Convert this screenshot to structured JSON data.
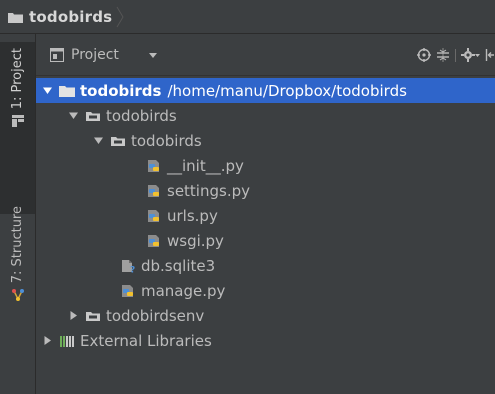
{
  "navbar": {
    "breadcrumb": "todobirds"
  },
  "sidebar": {
    "project_tab": "1: Project",
    "structure_tab": "7: Structure"
  },
  "panel": {
    "view_mode": "Project"
  },
  "tree": {
    "root_name": "todobirds",
    "root_path": "/home/manu/Dropbox/todobirds",
    "items": [
      {
        "label": "todobirds"
      },
      {
        "label": "todobirds"
      },
      {
        "label": "__init__.py"
      },
      {
        "label": "settings.py"
      },
      {
        "label": "urls.py"
      },
      {
        "label": "wsgi.py"
      },
      {
        "label": "db.sqlite3"
      },
      {
        "label": "manage.py"
      },
      {
        "label": "todobirdsenv"
      },
      {
        "label": "External Libraries"
      }
    ]
  },
  "colors": {
    "background": "#3c3f41",
    "selection": "#2f65ca",
    "folder": "#c9c9c9",
    "python_blue": "#4d8fd6",
    "python_yellow": "#f2c12e"
  }
}
